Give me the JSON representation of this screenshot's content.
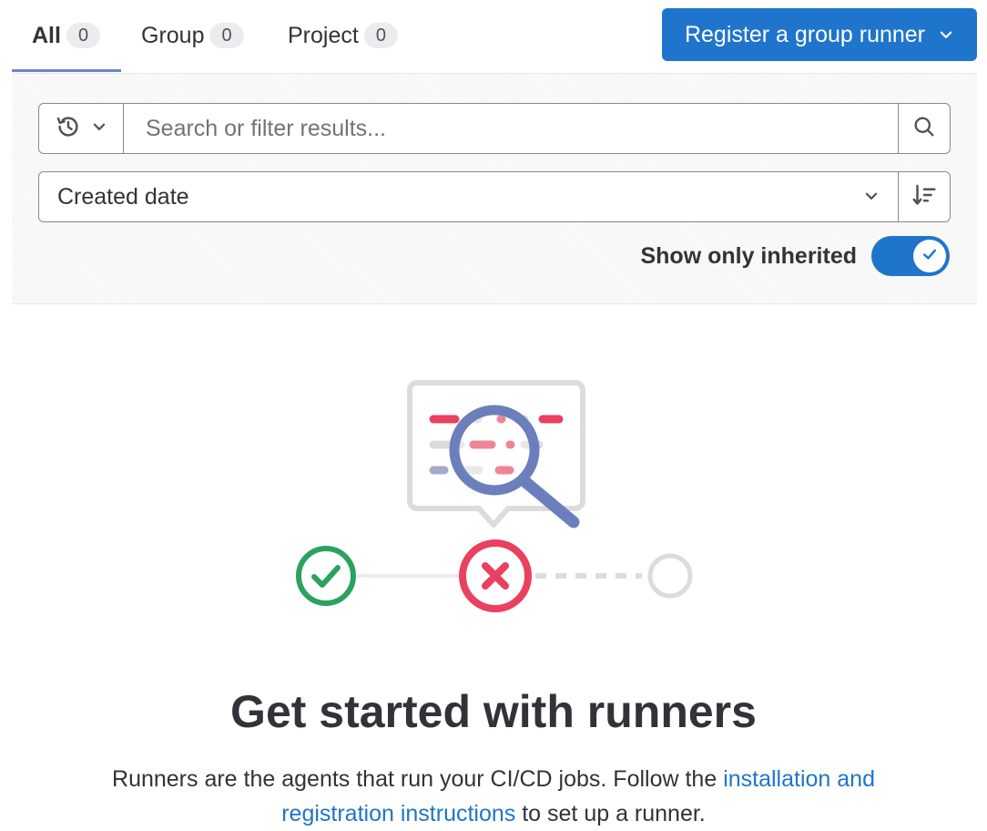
{
  "tabs": [
    {
      "label": "All",
      "count": "0",
      "active": true
    },
    {
      "label": "Group",
      "count": "0",
      "active": false
    },
    {
      "label": "Project",
      "count": "0",
      "active": false
    }
  ],
  "register_button": {
    "label": "Register a group runner"
  },
  "search": {
    "placeholder": "Search or filter results..."
  },
  "sort": {
    "selected": "Created date"
  },
  "toggle": {
    "label": "Show only inherited",
    "checked": true
  },
  "empty_state": {
    "title": "Get started with runners",
    "desc_before": "Runners are the agents that run your CI/CD jobs. Follow the ",
    "link_text": "installation and registration instructions",
    "desc_after": " to set up a runner."
  },
  "colors": {
    "accent": "#1f75cb",
    "success": "#2da160",
    "danger": "#e9415e",
    "muted": "#dcdcde",
    "illustration_blue": "#6b7fbd"
  },
  "icons": [
    "history-icon",
    "chevron-down-icon",
    "search-icon",
    "sort-direction-icon",
    "check-icon"
  ]
}
